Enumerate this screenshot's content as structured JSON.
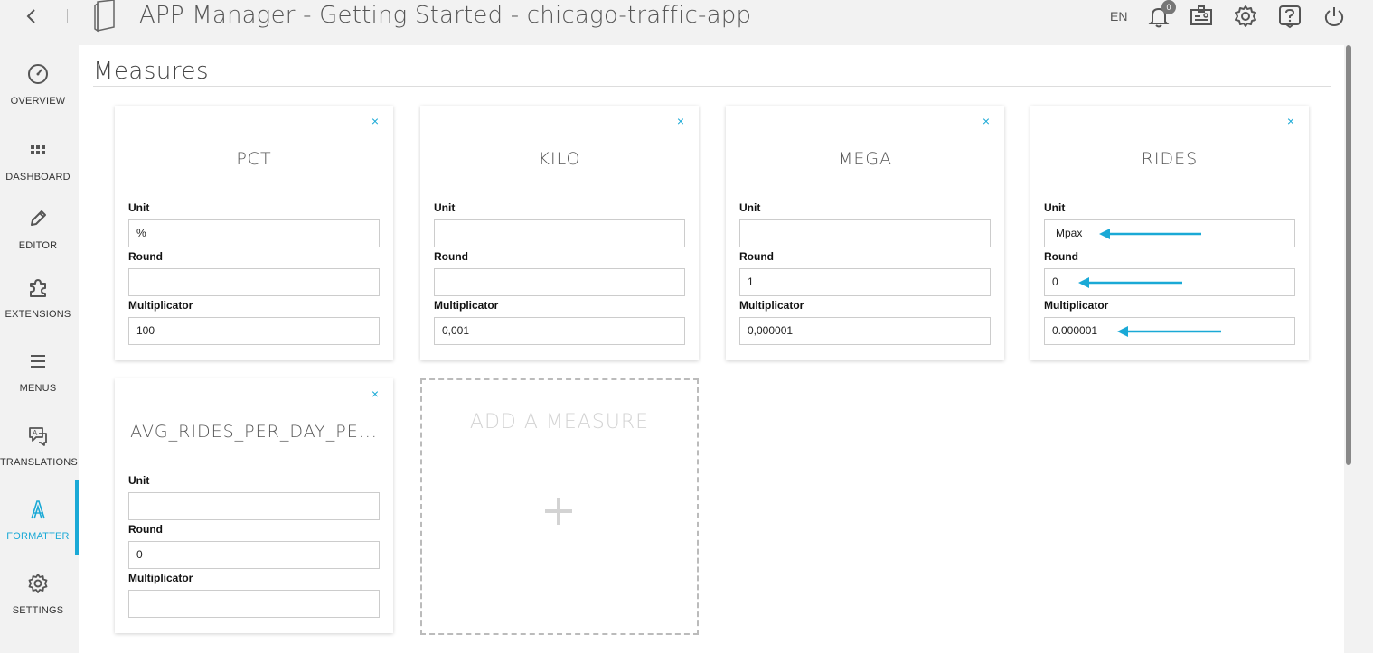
{
  "header": {
    "title": "APP Manager - Getting Started - chicago-traffic-app",
    "language": "EN",
    "notification_count": "0"
  },
  "sidebar": {
    "items": [
      {
        "label": "OVERVIEW",
        "icon": "gauge-icon"
      },
      {
        "label": "DASHBOARD",
        "icon": "grid-icon"
      },
      {
        "label": "EDITOR",
        "icon": "pencil-icon"
      },
      {
        "label": "EXTENSIONS",
        "icon": "puzzle-icon"
      },
      {
        "label": "MENUS",
        "icon": "menu-icon"
      },
      {
        "label": "TRANSLATIONS",
        "icon": "translate-icon"
      },
      {
        "label": "FORMATTER",
        "icon": "formatter-icon",
        "active": true
      },
      {
        "label": "SETTINGS",
        "icon": "gear-icon"
      }
    ],
    "accent": "#1aa9d6"
  },
  "main": {
    "title": "Measures",
    "field_labels": {
      "unit": "Unit",
      "round": "Round",
      "multiplicator": "Multiplicator"
    },
    "close_symbol": "×",
    "measures": [
      {
        "name": "PCT",
        "unit": "%",
        "round": "",
        "multiplicator": "100"
      },
      {
        "name": "KILO",
        "unit": "",
        "round": "",
        "multiplicator": "0,001"
      },
      {
        "name": "MEGA",
        "unit": "",
        "round": "1",
        "multiplicator": "0,000001"
      },
      {
        "name": "RIDES",
        "unit": "Mpax",
        "round": "0",
        "multiplicator": "0.000001"
      },
      {
        "name": "AVG_RIDES_PER_DAY_PE...",
        "unit": "",
        "round": "0",
        "multiplicator": ""
      }
    ],
    "add_label": "ADD A MEASURE"
  }
}
